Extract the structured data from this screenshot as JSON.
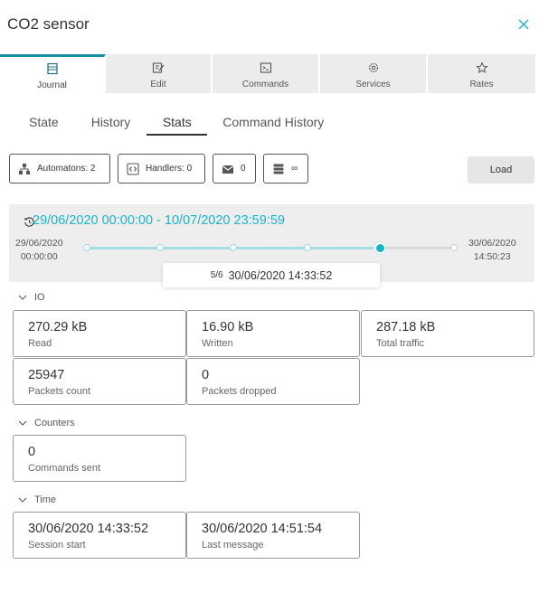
{
  "window": {
    "title": "CO2 sensor",
    "close_icon": "close-icon"
  },
  "tabs": [
    {
      "label": "Journal",
      "icon": "journal-icon",
      "active": true
    },
    {
      "label": "Edit",
      "icon": "edit-icon"
    },
    {
      "label": "Commands",
      "icon": "terminal-icon"
    },
    {
      "label": "Services",
      "icon": "gears-icon"
    },
    {
      "label": "Rates",
      "icon": "star-icon"
    }
  ],
  "subtabs": [
    {
      "label": "State"
    },
    {
      "label": "History"
    },
    {
      "label": "Stats",
      "active": true
    },
    {
      "label": "Command History"
    }
  ],
  "toolbar": {
    "automatons": "Automatons: 2",
    "handlers": "Handlers: 0",
    "messages": "0",
    "storage": "∞",
    "load": "Load"
  },
  "range": {
    "title": "29/06/2020 00:00:00 - 10/07/2020 23:59:59",
    "left_date": "29/06/2020",
    "left_time": "00:00:00",
    "right_date": "30/06/2020",
    "right_time": "14:50:23",
    "selected_index": "5/6",
    "selected_time": "30/06/2020 14:33:52",
    "points": 6,
    "selected_point": 5,
    "accent": "#1ab3c8"
  },
  "sections": {
    "io": {
      "title": "IO",
      "cards": [
        {
          "value": "270.29 kB",
          "label": "Read"
        },
        {
          "value": "16.90 kB",
          "label": "Written"
        },
        {
          "value": "287.18 kB",
          "label": "Total traffic"
        },
        {
          "value": "25947",
          "label": "Packets count"
        },
        {
          "value": "0",
          "label": "Packets dropped"
        }
      ]
    },
    "counters": {
      "title": "Counters",
      "cards": [
        {
          "value": "0",
          "label": "Commands sent"
        }
      ]
    },
    "time": {
      "title": "Time",
      "cards": [
        {
          "value": "30/06/2020 14:33:52",
          "label": "Session start"
        },
        {
          "value": "30/06/2020 14:51:54",
          "label": "Last message"
        }
      ]
    }
  }
}
